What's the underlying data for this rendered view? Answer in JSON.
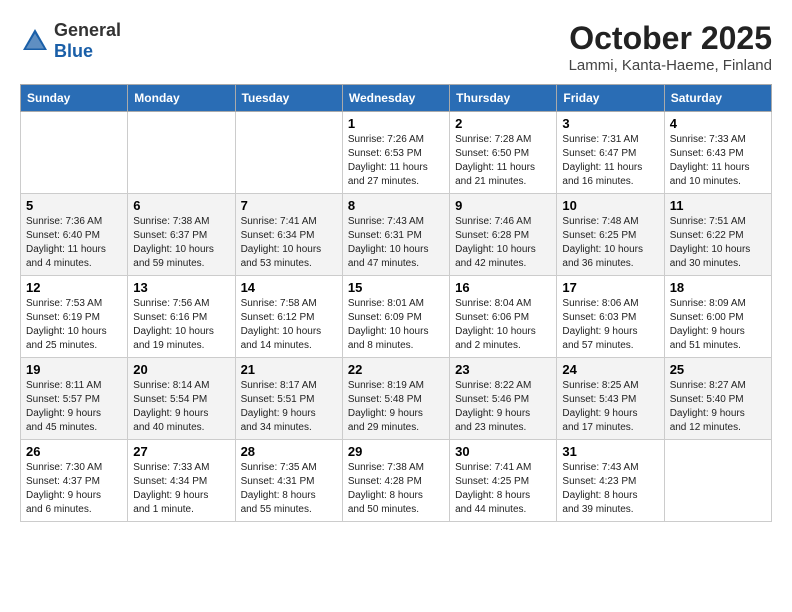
{
  "header": {
    "logo_general": "General",
    "logo_blue": "Blue",
    "month": "October 2025",
    "location": "Lammi, Kanta-Haeme, Finland"
  },
  "weekdays": [
    "Sunday",
    "Monday",
    "Tuesday",
    "Wednesday",
    "Thursday",
    "Friday",
    "Saturday"
  ],
  "weeks": [
    [
      {
        "day": "",
        "info": ""
      },
      {
        "day": "",
        "info": ""
      },
      {
        "day": "",
        "info": ""
      },
      {
        "day": "1",
        "info": "Sunrise: 7:26 AM\nSunset: 6:53 PM\nDaylight: 11 hours\nand 27 minutes."
      },
      {
        "day": "2",
        "info": "Sunrise: 7:28 AM\nSunset: 6:50 PM\nDaylight: 11 hours\nand 21 minutes."
      },
      {
        "day": "3",
        "info": "Sunrise: 7:31 AM\nSunset: 6:47 PM\nDaylight: 11 hours\nand 16 minutes."
      },
      {
        "day": "4",
        "info": "Sunrise: 7:33 AM\nSunset: 6:43 PM\nDaylight: 11 hours\nand 10 minutes."
      }
    ],
    [
      {
        "day": "5",
        "info": "Sunrise: 7:36 AM\nSunset: 6:40 PM\nDaylight: 11 hours\nand 4 minutes."
      },
      {
        "day": "6",
        "info": "Sunrise: 7:38 AM\nSunset: 6:37 PM\nDaylight: 10 hours\nand 59 minutes."
      },
      {
        "day": "7",
        "info": "Sunrise: 7:41 AM\nSunset: 6:34 PM\nDaylight: 10 hours\nand 53 minutes."
      },
      {
        "day": "8",
        "info": "Sunrise: 7:43 AM\nSunset: 6:31 PM\nDaylight: 10 hours\nand 47 minutes."
      },
      {
        "day": "9",
        "info": "Sunrise: 7:46 AM\nSunset: 6:28 PM\nDaylight: 10 hours\nand 42 minutes."
      },
      {
        "day": "10",
        "info": "Sunrise: 7:48 AM\nSunset: 6:25 PM\nDaylight: 10 hours\nand 36 minutes."
      },
      {
        "day": "11",
        "info": "Sunrise: 7:51 AM\nSunset: 6:22 PM\nDaylight: 10 hours\nand 30 minutes."
      }
    ],
    [
      {
        "day": "12",
        "info": "Sunrise: 7:53 AM\nSunset: 6:19 PM\nDaylight: 10 hours\nand 25 minutes."
      },
      {
        "day": "13",
        "info": "Sunrise: 7:56 AM\nSunset: 6:16 PM\nDaylight: 10 hours\nand 19 minutes."
      },
      {
        "day": "14",
        "info": "Sunrise: 7:58 AM\nSunset: 6:12 PM\nDaylight: 10 hours\nand 14 minutes."
      },
      {
        "day": "15",
        "info": "Sunrise: 8:01 AM\nSunset: 6:09 PM\nDaylight: 10 hours\nand 8 minutes."
      },
      {
        "day": "16",
        "info": "Sunrise: 8:04 AM\nSunset: 6:06 PM\nDaylight: 10 hours\nand 2 minutes."
      },
      {
        "day": "17",
        "info": "Sunrise: 8:06 AM\nSunset: 6:03 PM\nDaylight: 9 hours\nand 57 minutes."
      },
      {
        "day": "18",
        "info": "Sunrise: 8:09 AM\nSunset: 6:00 PM\nDaylight: 9 hours\nand 51 minutes."
      }
    ],
    [
      {
        "day": "19",
        "info": "Sunrise: 8:11 AM\nSunset: 5:57 PM\nDaylight: 9 hours\nand 45 minutes."
      },
      {
        "day": "20",
        "info": "Sunrise: 8:14 AM\nSunset: 5:54 PM\nDaylight: 9 hours\nand 40 minutes."
      },
      {
        "day": "21",
        "info": "Sunrise: 8:17 AM\nSunset: 5:51 PM\nDaylight: 9 hours\nand 34 minutes."
      },
      {
        "day": "22",
        "info": "Sunrise: 8:19 AM\nSunset: 5:48 PM\nDaylight: 9 hours\nand 29 minutes."
      },
      {
        "day": "23",
        "info": "Sunrise: 8:22 AM\nSunset: 5:46 PM\nDaylight: 9 hours\nand 23 minutes."
      },
      {
        "day": "24",
        "info": "Sunrise: 8:25 AM\nSunset: 5:43 PM\nDaylight: 9 hours\nand 17 minutes."
      },
      {
        "day": "25",
        "info": "Sunrise: 8:27 AM\nSunset: 5:40 PM\nDaylight: 9 hours\nand 12 minutes."
      }
    ],
    [
      {
        "day": "26",
        "info": "Sunrise: 7:30 AM\nSunset: 4:37 PM\nDaylight: 9 hours\nand 6 minutes."
      },
      {
        "day": "27",
        "info": "Sunrise: 7:33 AM\nSunset: 4:34 PM\nDaylight: 9 hours\nand 1 minute."
      },
      {
        "day": "28",
        "info": "Sunrise: 7:35 AM\nSunset: 4:31 PM\nDaylight: 8 hours\nand 55 minutes."
      },
      {
        "day": "29",
        "info": "Sunrise: 7:38 AM\nSunset: 4:28 PM\nDaylight: 8 hours\nand 50 minutes."
      },
      {
        "day": "30",
        "info": "Sunrise: 7:41 AM\nSunset: 4:25 PM\nDaylight: 8 hours\nand 44 minutes."
      },
      {
        "day": "31",
        "info": "Sunrise: 7:43 AM\nSunset: 4:23 PM\nDaylight: 8 hours\nand 39 minutes."
      },
      {
        "day": "",
        "info": ""
      }
    ]
  ]
}
